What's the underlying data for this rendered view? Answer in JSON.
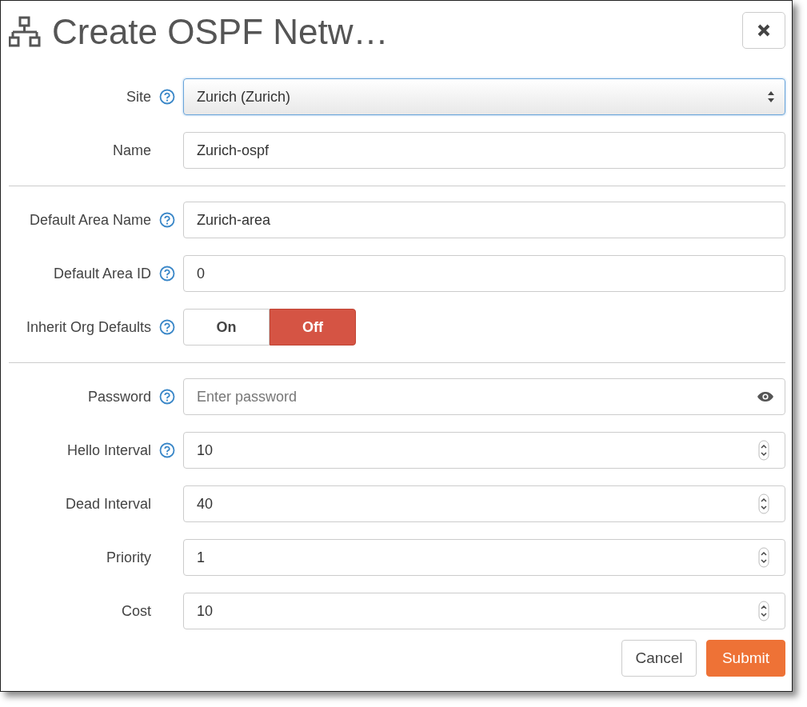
{
  "dialog": {
    "title": "Create OSPF Netw…"
  },
  "sections": [
    [
      {
        "kind": "select",
        "label": "Site",
        "help": true,
        "value": "Zurich (Zurich)"
      },
      {
        "kind": "text",
        "label": "Name",
        "help": false,
        "value": "Zurich-ospf"
      }
    ],
    [
      {
        "kind": "text",
        "label": "Default Area Name",
        "help": true,
        "value": "Zurich-area"
      },
      {
        "kind": "text",
        "label": "Default Area ID",
        "help": true,
        "value": "0"
      },
      {
        "kind": "toggle",
        "label": "Inherit Org Defaults",
        "help": true,
        "options": [
          {
            "label": "On",
            "selected": false
          },
          {
            "label": "Off",
            "selected": true
          }
        ]
      }
    ],
    [
      {
        "kind": "password",
        "label": "Password",
        "help": true,
        "placeholder": "Enter password"
      },
      {
        "kind": "number",
        "label": "Hello Interval",
        "help": true,
        "value": "10"
      },
      {
        "kind": "number",
        "label": "Dead Interval",
        "help": false,
        "value": "40"
      },
      {
        "kind": "number",
        "label": "Priority",
        "help": false,
        "value": "1"
      },
      {
        "kind": "number",
        "label": "Cost",
        "help": false,
        "value": "10"
      }
    ]
  ],
  "buttons": [
    {
      "kind": "secondary",
      "label": "Cancel"
    },
    {
      "kind": "primary",
      "label": "Submit"
    }
  ]
}
